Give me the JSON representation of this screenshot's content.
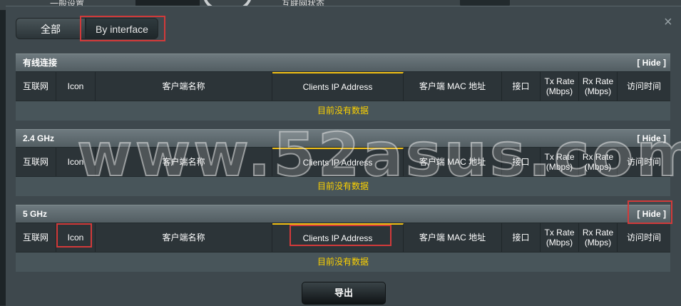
{
  "background": {
    "left_text": "一般设置",
    "center_text": "互联网状态"
  },
  "tabs": [
    {
      "label": "全部"
    },
    {
      "label": "By interface"
    }
  ],
  "close_symbol": "×",
  "hide_label": "[ Hide ]",
  "columns": [
    "互联网",
    "Icon",
    "客户端名称",
    "Clients IP Address",
    "客户端 MAC 地址",
    "接口",
    "Tx Rate\n(Mbps)",
    "Rx Rate\n(Mbps)",
    "访问时间"
  ],
  "sections": [
    {
      "title": "有线连接",
      "empty": "目前没有数据"
    },
    {
      "title": "2.4 GHz",
      "empty": "目前没有数据"
    },
    {
      "title": "5 GHz",
      "empty": "目前没有数据"
    }
  ],
  "export_label": "导出",
  "watermark": "www.52asus.com",
  "colors": {
    "accent": "#f3c115",
    "empty_text": "#fdd200",
    "highlight": "#d23a3a"
  }
}
